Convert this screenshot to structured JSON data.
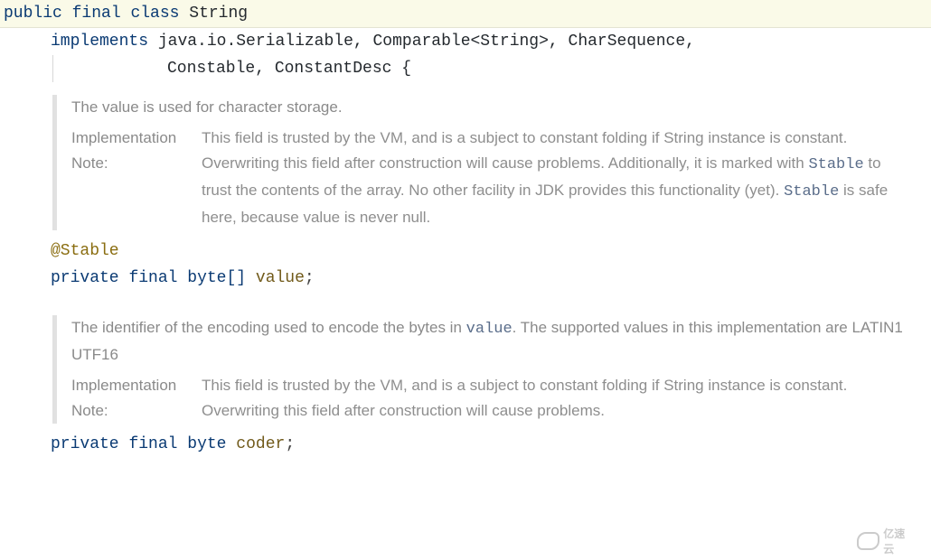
{
  "line1": {
    "public": "public",
    "final": "final",
    "class": "class",
    "name": "String"
  },
  "line2": {
    "implements": "implements",
    "rest": "java.io.Serializable, Comparable<String>, CharSequence,"
  },
  "line3": {
    "rest": "Constable, ConstantDesc {"
  },
  "doc1": {
    "summary": "The value is used for character storage.",
    "impl_label": "Implementation Note:",
    "impl_body_a": "This field is trusted by the VM, and is a subject to constant folding if String instance is constant. Overwriting this field after construction will cause problems. Additionally, it is marked with ",
    "code_a": "Stable",
    "impl_body_b": " to trust the contents of the array. No other facility in JDK provides this functionality (yet). ",
    "code_b": "Stable",
    "impl_body_c": " is safe here, because value is never null."
  },
  "field1": {
    "annotation": "@Stable",
    "private": "private",
    "final": "final",
    "type": "byte[]",
    "name": "value",
    "semi": ";"
  },
  "doc2": {
    "summary_a": "The identifier of the encoding used to encode the bytes in ",
    "code_a": "value",
    "summary_b": ". The supported values in this implementation are LATIN1 UTF16",
    "impl_label": "Implementation Note:",
    "impl_body": "This field is trusted by the VM, and is a subject to constant folding if String instance is constant. Overwriting this field after construction will cause problems."
  },
  "field2": {
    "private": "private",
    "final": "final",
    "type": "byte",
    "name": "coder",
    "semi": ";"
  },
  "watermark": "亿速云"
}
